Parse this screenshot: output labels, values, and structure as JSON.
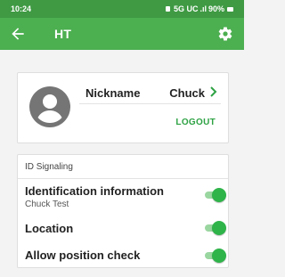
{
  "status_bar": {
    "time": "10:24",
    "network": "5G UC",
    "signal": ".ıl",
    "battery": "90%"
  },
  "app_bar": {
    "title": "HT",
    "back_icon": "arrow-left-icon",
    "settings_icon": "gear-icon"
  },
  "profile": {
    "avatar_icon": "account-circle-icon",
    "nickname_label": "Nickname",
    "nickname_value": "Chuck",
    "chevron_icon": "chevron-right-icon",
    "logout_label": "LOGOUT"
  },
  "id_signaling": {
    "header": "ID Signaling",
    "rows": [
      {
        "label": "Identification information",
        "sublabel": "Chuck Test",
        "enabled": true
      },
      {
        "label": "Location",
        "sublabel": "",
        "enabled": true
      },
      {
        "label": "Allow position check",
        "sublabel": "",
        "enabled": true
      }
    ]
  },
  "colors": {
    "status_bar": "#3f9a43",
    "app_bar": "#4caf50",
    "accent": "#2fb44a",
    "logout_text": "#2ea244",
    "background": "#f3f3f3"
  }
}
